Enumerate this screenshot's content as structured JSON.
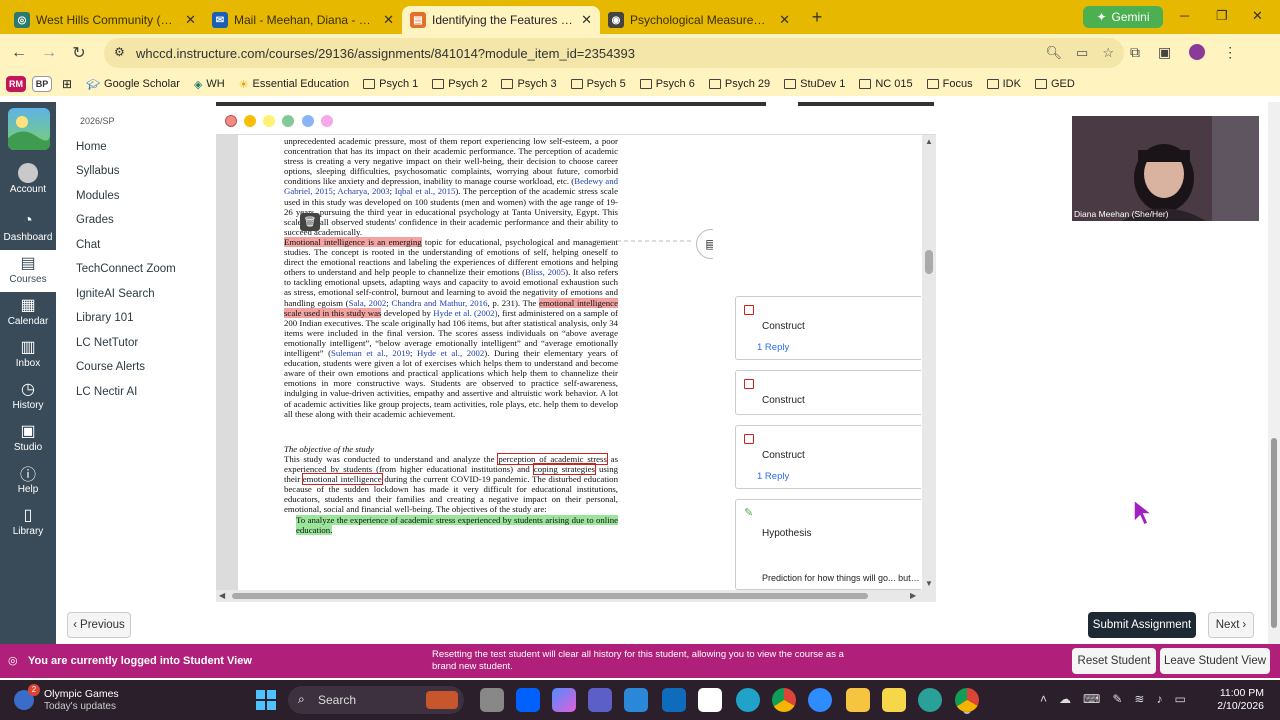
{
  "browser": {
    "tabs": [
      {
        "title": "West Hills Community (Faculty/",
        "color": "#2b7a6f"
      },
      {
        "title": "Mail - Meehan, Diana - Outlook",
        "color": "#1b5fb5"
      },
      {
        "title": "Identifying the Features of Rese",
        "color": "#e2702c"
      },
      {
        "title": "Psychological Measurement: Th",
        "color": "#444444"
      }
    ],
    "gemini_label": "Gemini",
    "url": "whccd.instructure.com/courses/29136/assignments/841014?module_item_id=2354393",
    "bookmarks": [
      "Google Scholar",
      "WH",
      "Essential Education",
      "Psych 1",
      "Psych 2",
      "Psych 3",
      "Psych 5",
      "Psych 6",
      "Psych 29",
      "StuDev 1",
      "NC 015",
      "Focus",
      "IDK",
      "GED"
    ],
    "profiles": [
      "RM",
      "BP"
    ]
  },
  "global_nav": [
    {
      "label": "Account",
      "icon": "account-icon"
    },
    {
      "label": "Dashboard",
      "icon": "dashboard-icon"
    },
    {
      "label": "Courses",
      "icon": "courses-icon"
    },
    {
      "label": "Calendar",
      "icon": "calendar-icon"
    },
    {
      "label": "Inbox",
      "icon": "inbox-icon"
    },
    {
      "label": "History",
      "icon": "history-icon"
    },
    {
      "label": "Studio",
      "icon": "studio-icon"
    },
    {
      "label": "Help",
      "icon": "help-icon"
    },
    {
      "label": "Library",
      "icon": "library-icon"
    }
  ],
  "course_nav": {
    "term": "2026/SP",
    "links": [
      "Home",
      "Syllabus",
      "Modules",
      "Grades",
      "Chat",
      "TechConnect Zoom",
      "IgniteAI Search",
      "Library 101",
      "LC NetTutor",
      "Course Alerts",
      "LC Nectir AI"
    ]
  },
  "doc": {
    "p1": "unprecedented academic pressure, most of them report experiencing low self-esteem, a poor concentration that has its impact on their academic performance. The perception of academic stress is creating a very negative impact on their well-being, their decision to choose career options, sleeping difficulties, psychosomatic complaints, worrying about future, comorbid conditions like anxiety and depression, inability to manage course workload, etc. (",
    "p1_ref1": "Bedewy and Gabriel, 2015",
    "p1_sep1": "; ",
    "p1_ref2": "Acharya, 2003",
    "p1_sep2": "; ",
    "p1_ref3": "Iqbal et al., 2015",
    "p1_tail": "). The perception of the academic stress scale used in this study was developed on 100 students (men and women) with the age range of 19-26 years, pursuing the third year in educational psychology at Tanta University, Egypt. This scale overall observed students' confidence in their academic performance and their ability to succeed academically.",
    "p2_hl": "Emotional intelligence is an emerging",
    "p2a": " topic for educational, psychological and management studies. The concept is rooted in the understanding of emotions of self, helping oneself to direct the emotional reactions and labeling the experiences of different emotions and helping others to understand and help people to channelize their emotions (",
    "p2_ref1": "Bliss, 2005",
    "p2b": "). It also refers to tackling emotional upsets, adapting ways and capacity to avoid emotional exhaustion such as stress, emotional self-control, burnout and learning to avoid the negativity of emotions and handling egoism (",
    "p2_ref2": "Sala, 2002",
    "p2_sep": "; ",
    "p2_ref3": "Chandra and Mathur, 2016",
    "p2c": ", p. 231). The ",
    "p2_hl2": "emotional intelligence scale used in this study was",
    "p2d": " developed by ",
    "p2_ref4": "Hyde et al. (2002)",
    "p2e": ", first administered on a sample of 200 Indian executives. The scale originally had 106 items, but after statistical analysis, only 34 items were included in the final version. The scores assess individuals on “above average emotionally intelligent”, “below average emotionally intelligent” and “average emotionally intelligent” (",
    "p2_ref5": "Suleman et al., 2019",
    "p2_sep2": "; ",
    "p2_ref6": "Hyde et al., 2002",
    "p2f": "). During their elementary years of education, students were given a lot of exercises which helps them to understand and become aware of their own emotions and practical applications which help them to channelize their emotions in more constructive ways. Students are observed to practice self-awareness, indulging in value-driven activities, empathy and assertive and altruistic work behavior. A lot of academic activities like group projects, team activities, role plays, etc. help them to develop all these along with their academic achievement.",
    "heading": "The objective of the study",
    "p3a": "This study was conducted to understand and analyze the ",
    "p3_box1": "perception of academic stress",
    "p3b": " as experienced by students (from higher educational institutions) and ",
    "p3_box2": "coping strategies",
    "p3c": " using their ",
    "p3_box3": "emotional intelligence",
    "p3d": " during the current COVID-19 pandemic. The disturbed education because of the sudden lockdown has made it very difficult for educational institutions, educators, students and their families and creating a negative impact on their personal, emotional, social and financial well-being. The objectives of the study are:",
    "p4_hl": "To analyze the experience of academic stress experienced by students arising due to online education."
  },
  "annotation_colors": [
    "#f28b82",
    "#fbbc04",
    "#fff176",
    "#81c995",
    "#8ab4f8",
    "#f8a8e8"
  ],
  "comments": [
    {
      "title": "Construct",
      "reply": "1 Reply"
    },
    {
      "title": "Construct",
      "reply": ""
    },
    {
      "title": "Construct",
      "reply": "1 Reply"
    },
    {
      "title": "Hypothesis",
      "body": "Prediction for how things will go... but it can also be statements like this...."
    }
  ],
  "video": {
    "name": "Diana Meehan (She/Her)"
  },
  "buttons": {
    "previous": "Previous",
    "submit": "Submit Assignment",
    "next": "Next"
  },
  "student_view": {
    "message": "You are currently logged into Student View",
    "note": "Resetting the test student will clear all history for this student, allowing you to view the course as a brand new student.",
    "reset": "Reset Student",
    "leave": "Leave Student View"
  },
  "taskbar": {
    "weather_badge": "2",
    "news_title": "Olympic Games",
    "news_sub": "Today's updates",
    "search_placeholder": "Search",
    "time": "11:00 PM",
    "date": "2/10/2026"
  },
  "colors": {
    "brand_nav": "#394b58",
    "student_view": "#b0207a",
    "submit": "#1f2933",
    "link": "#2b6de2"
  }
}
